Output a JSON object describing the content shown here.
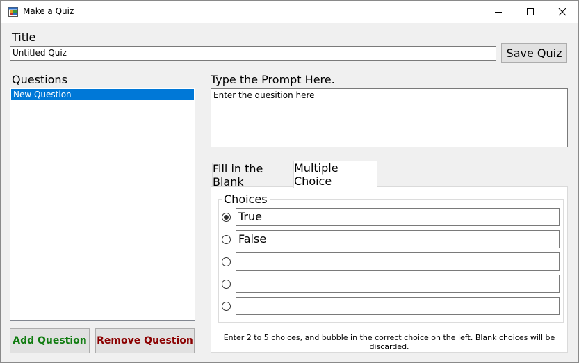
{
  "window": {
    "title": "Make a Quiz",
    "icon": "app-form-icon",
    "controls": [
      "minimize-icon",
      "maximize-icon",
      "close-icon"
    ]
  },
  "title_section": {
    "label": "Title",
    "value": "Untitled Quiz",
    "save_button": "Save Quiz"
  },
  "questions": {
    "label": "Questions",
    "items": [
      "New Question"
    ],
    "selected_index": 0,
    "add_button": "Add Question",
    "remove_button": "Remove Question",
    "add_color": "#107c10",
    "remove_color": "#8b0000"
  },
  "prompt": {
    "label": "Type the Prompt Here.",
    "value": "Enter the quesition here"
  },
  "tabs": [
    {
      "label": "Fill in the Blank",
      "active": false
    },
    {
      "label": "Multiple Choice",
      "active": true
    }
  ],
  "choices": {
    "label": "Choices",
    "items": [
      {
        "text": "True",
        "selected": true
      },
      {
        "text": "False",
        "selected": false
      },
      {
        "text": "",
        "selected": false
      },
      {
        "text": "",
        "selected": false
      },
      {
        "text": "",
        "selected": false
      }
    ],
    "hint": "Enter 2 to 5 choices, and bubble in the correct choice on the left.  Blank choices will be discarded."
  },
  "colors": {
    "selection": "#0078d7",
    "window_bg": "#f0f0f0"
  }
}
